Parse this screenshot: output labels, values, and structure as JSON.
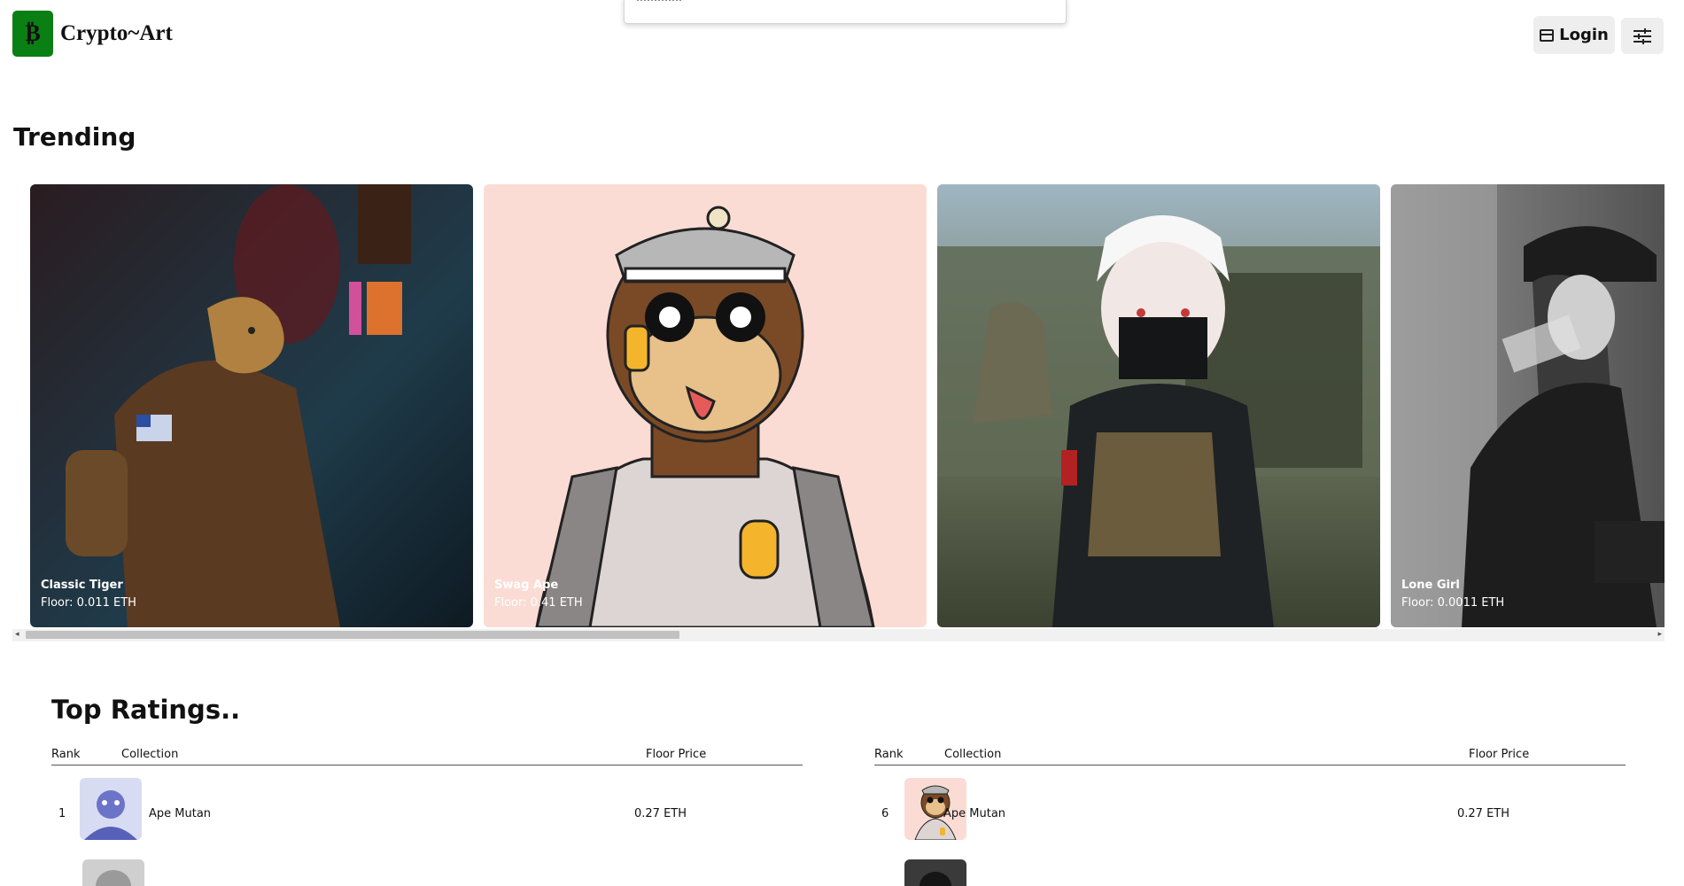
{
  "header": {
    "logo_glyph": "₿",
    "brand": "Crypto~Art",
    "login_label": "Login",
    "login_icon": "window-icon",
    "settings_icon": "sliders-icon",
    "brand_color": "#0a7f14"
  },
  "trending": {
    "title": "Trending",
    "cards": [
      {
        "name": "Classic Tiger",
        "floor": "Floor: 0.011 ETH"
      },
      {
        "name": "Swag Ape",
        "floor": "Floor: 0.41 ETH"
      },
      {
        "name": "",
        "floor": ""
      },
      {
        "name": "Lone Girl",
        "floor": "Floor: 0.0011 ETH"
      }
    ]
  },
  "ratings": {
    "title": "Top Ratings..",
    "columns": {
      "rank": "Rank",
      "collection": "Collection",
      "floor": "Floor Price"
    },
    "left_rows": [
      {
        "rank": "1",
        "collection": "Ape Mutan",
        "price": "0.27 ETH"
      }
    ],
    "right_rows": [
      {
        "rank": "6",
        "collection": "Ape Mutan",
        "price": "0.27 ETH"
      }
    ]
  }
}
